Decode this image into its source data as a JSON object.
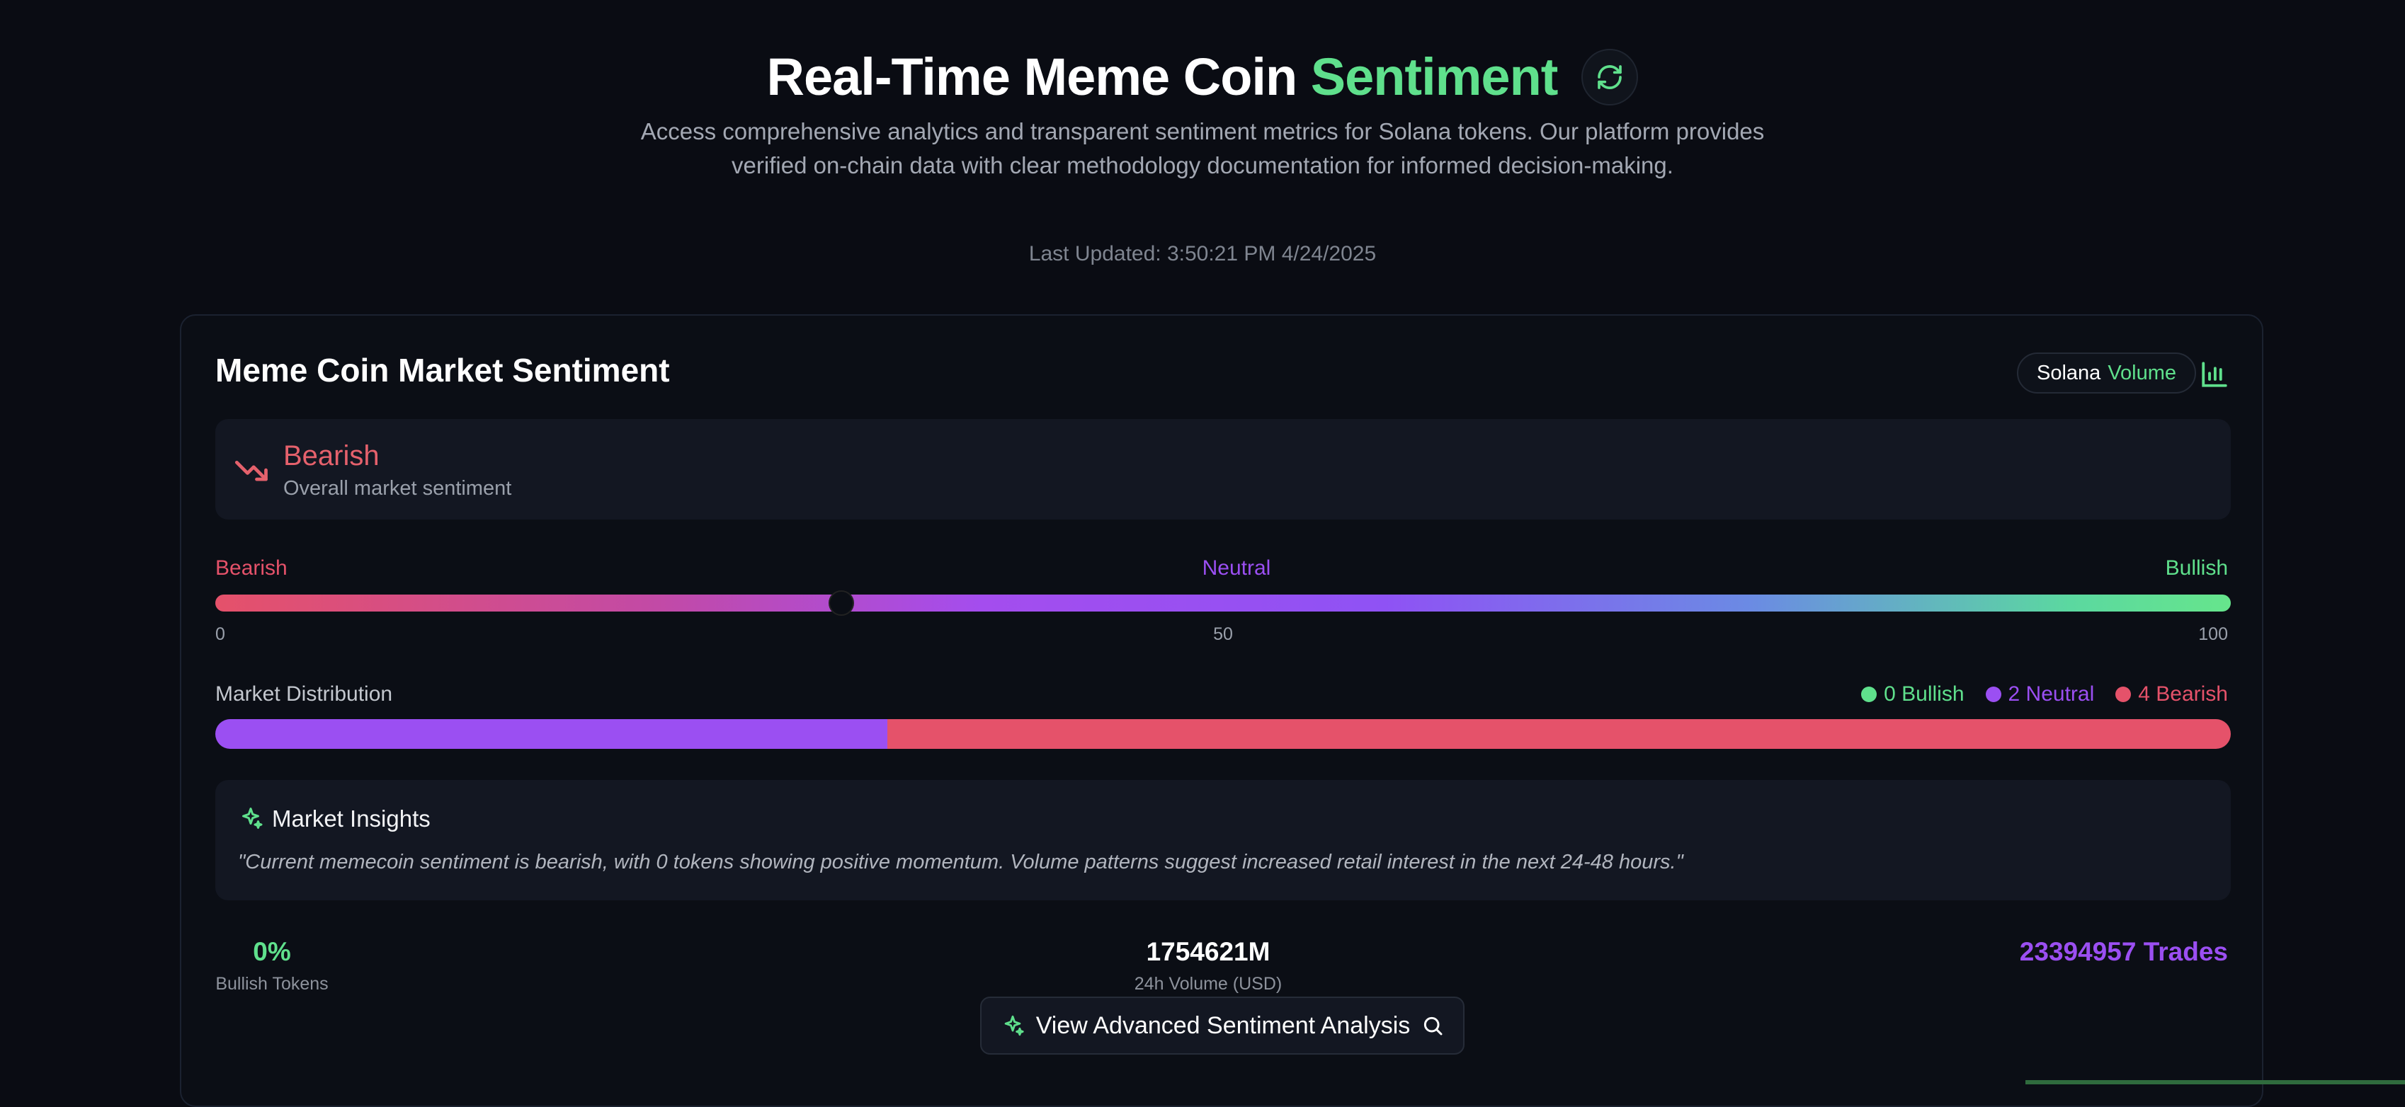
{
  "hero": {
    "title_main": "Real-Time Meme Coin",
    "title_accent": "Sentiment",
    "subtitle": "Access comprehensive analytics and transparent sentiment metrics for Solana tokens. Our platform provides verified on-chain data with clear methodology documentation for informed decision-making.",
    "last_updated": "Last Updated: 3:50:21 PM 4/24/2025"
  },
  "card": {
    "title": "Meme Coin Market Sentiment",
    "chip_network": "Solana",
    "chip_metric": "Volume",
    "sentiment": {
      "label": "Bearish",
      "sublabel": "Overall market sentiment",
      "score": 31
    },
    "gauge": {
      "left_label": "Bearish",
      "mid_label": "Neutral",
      "right_label": "Bullish",
      "ticks": [
        "0",
        "50",
        "100"
      ]
    },
    "distribution": {
      "label": "Market Distribution",
      "bullish_count": 0,
      "neutral_count": 2,
      "bearish_count": 4,
      "legend": {
        "bullish": "0 Bullish",
        "neutral": "2 Neutral",
        "bearish": "4 Bearish"
      }
    },
    "insights": {
      "title": "Market Insights",
      "quote": "\"Current memecoin sentiment is bearish, with 0 tokens showing positive momentum. Volume patterns suggest increased retail interest in the next 24-48 hours.\""
    },
    "stats": {
      "bullish_pct": "0%",
      "bullish_label": "Bullish Tokens",
      "volume": "1754621M",
      "volume_label": "24h Volume (USD)",
      "trades": "23394957 Trades"
    },
    "advanced_button": "View Advanced Sentiment Analysis"
  },
  "colors": {
    "accent_green": "#5fe08c",
    "bearish_red": "#e5526a",
    "neutral_purple": "#9b4ff2"
  },
  "icons": [
    "refresh-icon",
    "bar-chart-icon",
    "trending-down-icon",
    "sparkle-icon",
    "search-icon"
  ]
}
